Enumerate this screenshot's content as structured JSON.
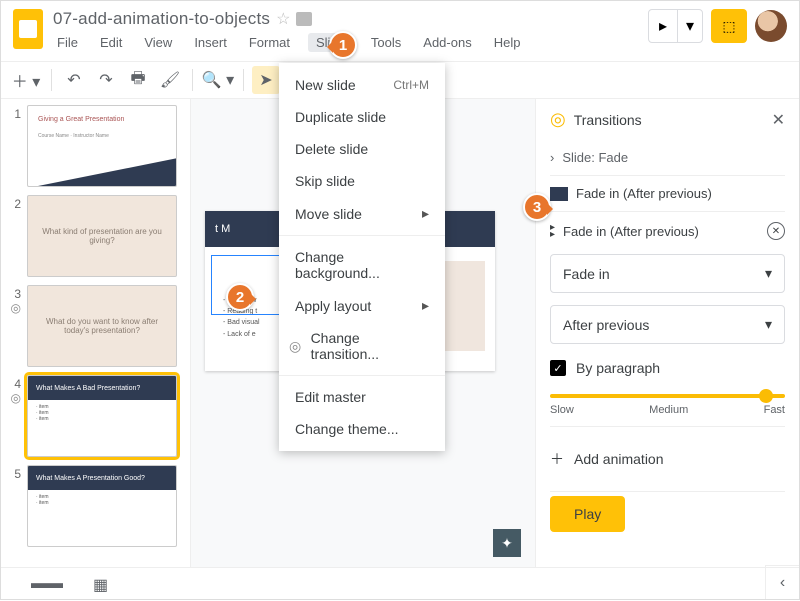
{
  "doc": {
    "title": "07-add-animation-to-objects"
  },
  "menus": {
    "file": "File",
    "edit": "Edit",
    "view": "View",
    "insert": "Insert",
    "format": "Format",
    "slide": "Slide",
    "tools": "Tools",
    "addons": "Add-ons",
    "help": "Help"
  },
  "dropdown": {
    "new_slide": "New slide",
    "new_slide_kbd": "Ctrl+M",
    "duplicate": "Duplicate slide",
    "delete": "Delete slide",
    "skip": "Skip slide",
    "move": "Move slide",
    "change_bg": "Change background...",
    "apply_layout": "Apply layout",
    "change_transition": "Change transition...",
    "edit_master": "Edit master",
    "change_theme": "Change theme..."
  },
  "panel": {
    "title": "Transitions",
    "slide_label": "Slide: Fade",
    "anim1": "Fade in  (After previous)",
    "anim2": "Fade in  (After previous)",
    "select1": "Fade in",
    "select2": "After previous",
    "by_para": "By paragraph",
    "slow": "Slow",
    "medium": "Medium",
    "fast": "Fast",
    "add": "Add animation",
    "play": "Play"
  },
  "thumbs": {
    "n1": "1",
    "n2": "2",
    "n3": "3",
    "n4": "4",
    "n5": "5",
    "t1_title": "Giving a Great Presentation",
    "t1_sub": "Course Name · Instructor Name",
    "t2": "What kind of presentation are you giving?",
    "t3": "What do you want to know after today's presentation?",
    "t4": "What Makes A Bad Presentation?",
    "t5": "What Makes A Presentation Good?"
  },
  "slide": {
    "title": "t M",
    "b1": "Not know",
    "b2": "Reading t",
    "b3": "Bad visual",
    "b4": "Lack of e"
  },
  "markers": {
    "m1": "1",
    "m2": "2",
    "m3": "3"
  }
}
